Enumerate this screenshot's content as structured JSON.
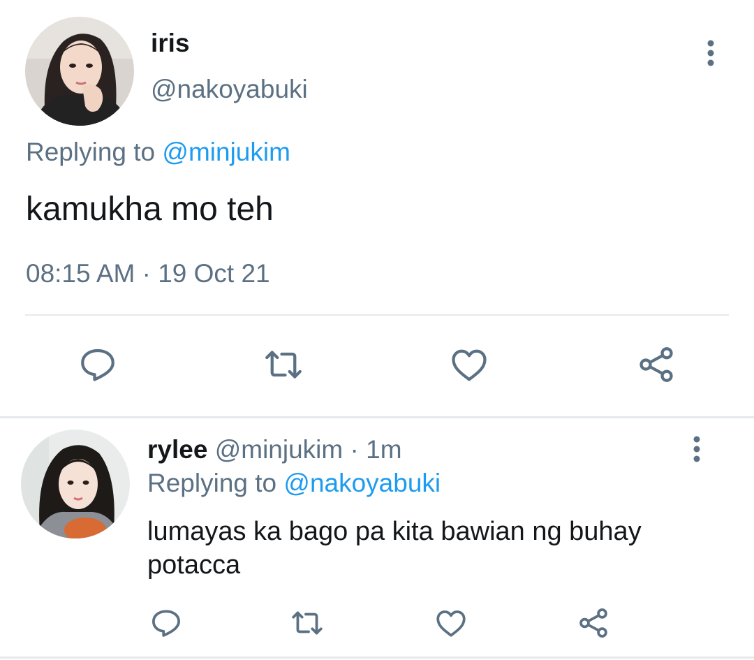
{
  "main_tweet": {
    "display_name": "iris",
    "handle": "@nakoyabuki",
    "replying_prefix": "Replying to",
    "replying_to": "@minjukim",
    "text": "kamukha mo teh",
    "timestamp": "08:15 AM · 19 Oct 21",
    "actions": [
      "reply-icon",
      "retweet-icon",
      "like-icon",
      "share-icon"
    ]
  },
  "reply_tweet": {
    "display_name": "rylee",
    "handle": "@minjukim",
    "separator": "·",
    "age": "1m",
    "replying_prefix": "Replying to",
    "replying_to": "@nakoyabuki",
    "text_line1": "lumayas ka bago pa kita bawian ng buhay",
    "text_line2": "potacca",
    "actions": [
      "reply-icon",
      "retweet-icon",
      "like-icon",
      "share-icon"
    ]
  },
  "colors": {
    "text": "#14171a",
    "secondary": "#5b7083",
    "link": "#1d9bf0",
    "divider": "#e6e9ec",
    "icon": "#5b7083"
  }
}
